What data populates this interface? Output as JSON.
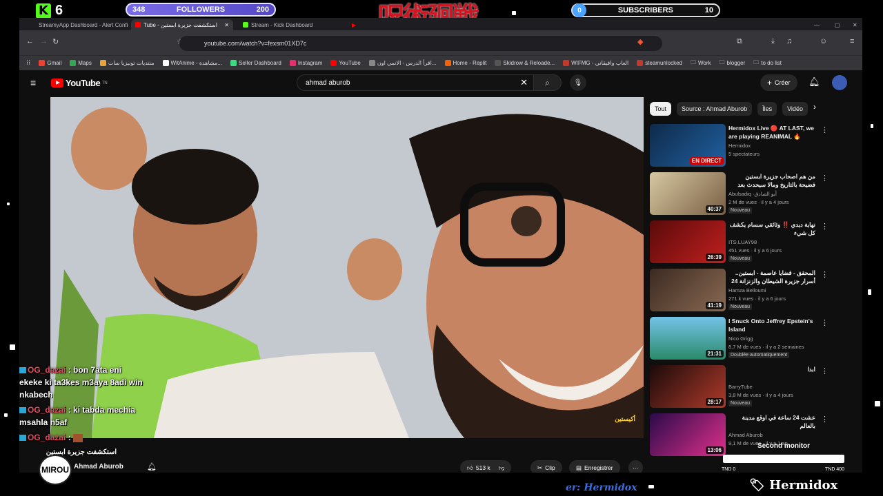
{
  "overlay": {
    "kick_count": "6",
    "followers": {
      "current": "348",
      "label": "FOLLOWERS",
      "goal": "200"
    },
    "subscribers": {
      "current": "0",
      "label": "SUBSCRIBERS",
      "goal": "10"
    },
    "jjk_logo": "呪術廻戦",
    "second_monitor": "Second monitor",
    "tnd_left": "TND 0",
    "tnd_right": "TND 400",
    "hermidox_tag": "Hermidox",
    "ticker": "er: Hermidox",
    "avatar_text": "MIROU",
    "chat": [
      {
        "user": "OG_dazai",
        "text": "bon 7ata eni ekeke ki ta3kes m3aya 8adi win nkabech"
      },
      {
        "user": "OG_dazai",
        "text": "ki tabda mechia msahla n5af"
      },
      {
        "user": "OG_dazai",
        "text": ""
      }
    ]
  },
  "browser": {
    "tabs": [
      {
        "label": "StreamyApp Dashboard - Alert Config",
        "color": "#1da1f2"
      },
      {
        "label": "Tube - استكشفت جزيرة ابستين",
        "color": "#ff0000"
      },
      {
        "label": "Stream - Kick Dashboard",
        "color": "#53fc18"
      }
    ],
    "url": "youtube.com/watch?v=fexsm01XD7c",
    "bookmarks": [
      {
        "label": "Gmail",
        "color": "#ea4335"
      },
      {
        "label": "Maps",
        "color": "#34a853"
      },
      {
        "label": "منتديات تونيزيا سات",
        "color": "#e8a33d"
      },
      {
        "label": "WitAnime - مشاهدة...",
        "color": "#ffffff"
      },
      {
        "label": "Seller Dashboard",
        "color": "#3ddc84"
      },
      {
        "label": "Instagram",
        "color": "#e1306c"
      },
      {
        "label": "YouTube",
        "color": "#ff0000"
      },
      {
        "label": "اقرأ الدرس - الانمي اون...",
        "color": "#888888"
      },
      {
        "label": "Home - Replit",
        "color": "#f26207"
      },
      {
        "label": "Skidrow & Reloade...",
        "color": "#555555"
      },
      {
        "label": "WIFMG - العاب واقيقاني",
        "color": "#c0392b"
      },
      {
        "label": "steamunlocked",
        "color": "#c0392b"
      },
      {
        "label": "Work",
        "color": "#aaaaaa"
      },
      {
        "label": "blogger",
        "color": "#aaaaaa"
      },
      {
        "label": "to do list",
        "color": "#aaaaaa"
      }
    ]
  },
  "youtube": {
    "logo": "YouTube",
    "logo_suffix": "TN",
    "search_query": "ahmad aburob",
    "create_label": "Créer",
    "chips": [
      "Tout",
      "Source : Ahmad Aburob",
      "Îles",
      "Vidéo"
    ],
    "video_overlay_text": "أكيستين",
    "channel_name": "Ahmad Aburob",
    "video_title_overlay": "استكشفت جزيرة ابستين",
    "likes": "513 k",
    "clip_label": "Clip",
    "save_label": "Enregistrer",
    "recommendations": [
      {
        "title": "Hermidox Live 🔴 AT LAST, we are playing REANIMAL 🔥",
        "channel": "Hermidox",
        "meta": "5 spectateurs",
        "badge": "",
        "duration": "EN DIRECT"
      },
      {
        "title": "من هم اصحاب جزيرة ابستين فضيحة بالتاريخ ومالا سيحدث بعد التسريبات",
        "channel": "Abulsadiq ·أبو الصادق",
        "meta": "2 M de vues · il y a 4 jours",
        "badge": "Nouveau",
        "duration": "40:37"
      },
      {
        "title": "نهاية ديدي ‼️ وثائقي سسام يكشف كل شيء",
        "channel": "ITS.LUAY98",
        "meta": "451 vues · il y a 6 jours",
        "badge": "Nouveau",
        "duration": "26:39"
      },
      {
        "title": "المحقق - قضايا عاصمة - ابستين.. أسرار جزيرة الشيطان والزنزانة 24 ‼️",
        "channel": "Hamza Belloumi",
        "meta": "271 k vues · il y a 6 jours",
        "badge": "Nouveau",
        "duration": "41:19"
      },
      {
        "title": "I Snuck Onto Jeffrey Epstein's Island",
        "channel": "Nico Grigg",
        "meta": "8,7 M de vues · il y a 2 semaines",
        "badge": "Doublée automatiquement",
        "duration": "21:31"
      },
      {
        "title": "ابدا",
        "channel": "BarryTube",
        "meta": "3,8 M de vues · il y a 4 jours",
        "badge": "Nouveau",
        "duration": "28:17"
      },
      {
        "title": "عشت 24 ساعة في اوقع مدينة بالعالم",
        "channel": "Ahmad Aburob",
        "meta": "9,1 M de vues · il y a 1 an",
        "badge": "",
        "duration": "13:06"
      }
    ]
  }
}
